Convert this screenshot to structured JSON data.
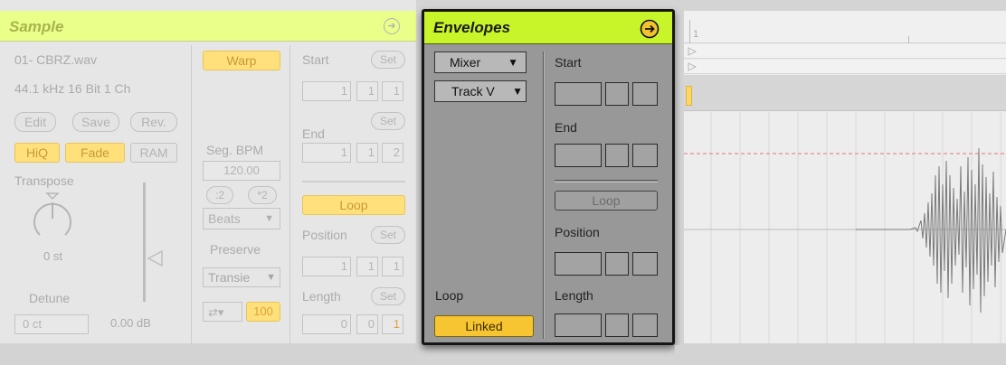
{
  "sample": {
    "title": "Sample",
    "filename": "01- CBRZ.wav",
    "fileinfo": "44.1 kHz 16 Bit 1 Ch",
    "edit": "Edit",
    "save": "Save",
    "rev": "Rev.",
    "hiq": "HiQ",
    "fade": "Fade",
    "ram": "RAM",
    "transpose_label": "Transpose",
    "transpose_value": "0 st",
    "detune_label": "Detune",
    "detune_value": "0 ct",
    "gain_value": "0.00 dB",
    "warp": "Warp",
    "seg_bpm_label": "Seg. BPM",
    "seg_bpm_value": "120.00",
    "half": ":2",
    "double": "*2",
    "warp_mode": "Beats",
    "preserve_label": "Preserve",
    "preserve_value": "Transie",
    "loop_mode_value": "100",
    "start_label": "Start",
    "start_set": "Set",
    "start_values": [
      "1",
      "1",
      "1"
    ],
    "end_label": "End",
    "end_set": "Set",
    "end_values": [
      "1",
      "1",
      "2"
    ],
    "loop_button": "Loop",
    "position_label": "Position",
    "position_set": "Set",
    "position_values": [
      "1",
      "1",
      "1"
    ],
    "length_label": "Length",
    "length_set": "Set",
    "length_values": [
      "0",
      "0",
      "1"
    ]
  },
  "envelopes": {
    "title": "Envelopes",
    "device_chooser": "Mixer",
    "control_chooser": "Track V",
    "start_label": "Start",
    "end_label": "End",
    "loop_button": "Loop",
    "position_label": "Position",
    "loop_label": "Loop",
    "linked_button": "Linked",
    "length_label": "Length"
  },
  "ruler": {
    "marker": "1"
  },
  "colors": {
    "header_green": "#e9ff8a",
    "envelope_header": "#c8f52a",
    "accent_yellow": "#ffe07a",
    "linked_yellow": "#f7c531"
  }
}
